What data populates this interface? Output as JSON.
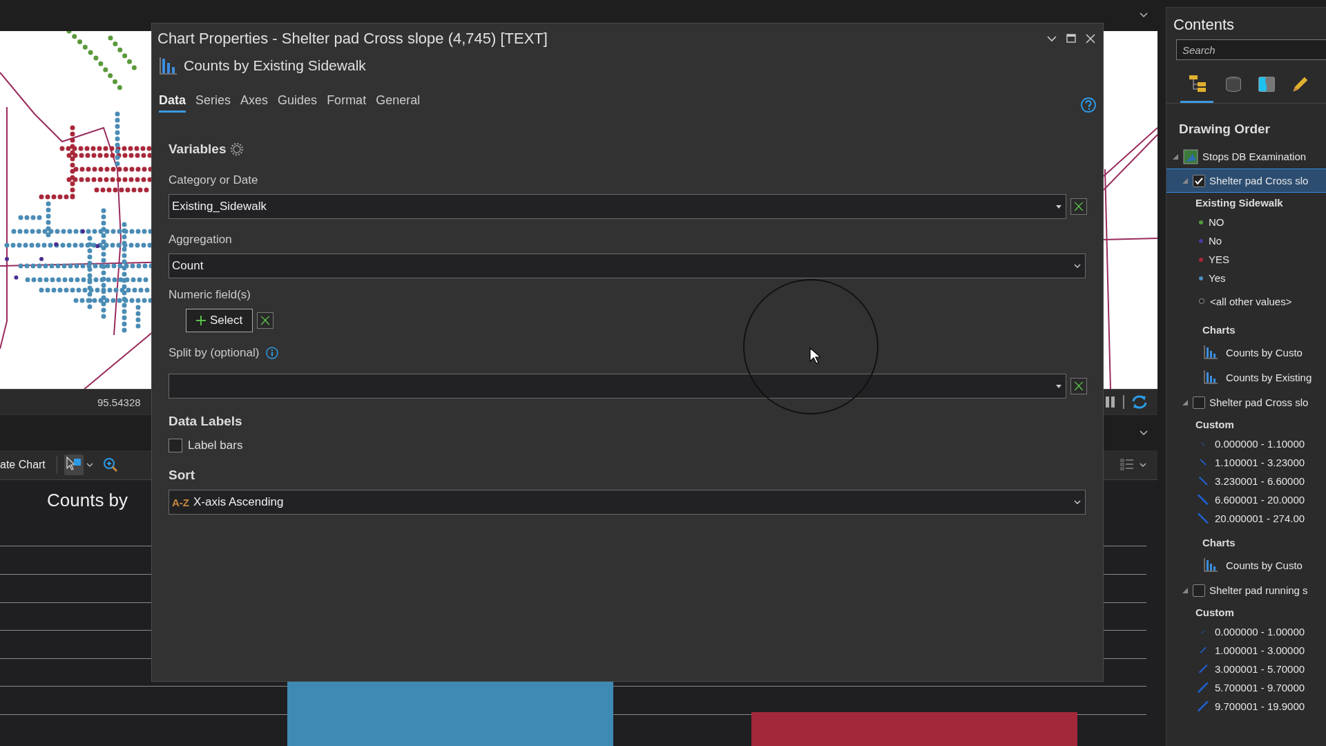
{
  "app": {
    "status_reading": "95.54328",
    "chart_pane": {
      "toolbar_label": "ate Chart",
      "chart_title": "Counts by"
    }
  },
  "dialog": {
    "title": "Chart Properties - Shelter pad Cross slope (4,745) [TEXT]",
    "chart_name": "Counts by Existing Sidewalk",
    "tabs": [
      {
        "label": "Data",
        "selected": true
      },
      {
        "label": "Series",
        "selected": false
      },
      {
        "label": "Axes",
        "selected": false
      },
      {
        "label": "Guides",
        "selected": false
      },
      {
        "label": "Format",
        "selected": false
      },
      {
        "label": "General",
        "selected": false
      }
    ],
    "variables": {
      "heading": "Variables",
      "fields": [
        {
          "kind": "dropdown",
          "label": "Category or Date",
          "value": "Existing_Sidewalk",
          "clearable": true,
          "info": false
        },
        {
          "kind": "dropdown",
          "label": "Aggregation",
          "value": "Count",
          "clearable": false,
          "info": false
        },
        {
          "kind": "select",
          "label": "Numeric field(s)",
          "button": "Select",
          "clearable": true,
          "info": false
        },
        {
          "kind": "dropdown",
          "label": "Split by (optional)",
          "clearable": true,
          "info": true
        }
      ]
    },
    "data_labels": {
      "heading": "Data Labels",
      "checkbox": {
        "label": "Label bars",
        "checked": false
      }
    },
    "sort": {
      "heading": "Sort",
      "icon_text": "A-Z",
      "value": "X-axis Ascending"
    }
  },
  "contents": {
    "title": "Contents",
    "search": {
      "placeholder": "Search"
    },
    "tabs": [
      {
        "kind": "drawing-order",
        "selected": true
      },
      {
        "kind": "source",
        "selected": false
      },
      {
        "kind": "map",
        "selected": false
      },
      {
        "kind": "editing",
        "selected": false
      }
    ],
    "heading": "Drawing Order",
    "tree": [
      {
        "label": "Stops DB Examination",
        "expanded": true,
        "children": [
          {
            "label": "Shelter pad Cross slo",
            "checked": true,
            "selected": true,
            "expanded": true,
            "legend": {
              "heading": "Existing Sidewalk",
              "items": [
                {
                  "label": "NO",
                  "kind": "point",
                  "color": "#4f9a3c"
                },
                {
                  "label": "No",
                  "kind": "point",
                  "color": "#4b3a9a"
                },
                {
                  "label": "YES",
                  "kind": "point",
                  "color": "#a8283a"
                },
                {
                  "label": "Yes",
                  "kind": "point",
                  "color": "#4a8ec0"
                },
                {
                  "label": "<all other values>",
                  "kind": "point",
                  "color": "#1e1e1e"
                }
              ]
            },
            "charts": {
              "heading": "Charts",
              "items": [
                "Counts by Custo",
                "Counts by Existing"
              ]
            }
          },
          {
            "label": "Shelter pad Cross slo",
            "checked": false,
            "selected": false,
            "expanded": true,
            "legend": {
              "heading": "Custom",
              "items": [
                {
                  "label": "0.000000 - 1.10000",
                  "kind": "line-down"
                },
                {
                  "label": "1.100001 - 3.23000",
                  "kind": "line-down"
                },
                {
                  "label": "3.230001 - 6.60000",
                  "kind": "line-down"
                },
                {
                  "label": "6.600001 - 20.0000",
                  "kind": "line-down"
                },
                {
                  "label": "20.000001 - 274.00",
                  "kind": "line-down"
                }
              ]
            },
            "charts": {
              "heading": "Charts",
              "items": [
                "Counts by Custo"
              ]
            }
          },
          {
            "label": "Shelter pad running s",
            "checked": false,
            "selected": false,
            "expanded": true,
            "legend": {
              "heading": "Custom",
              "items": [
                {
                  "label": "0.000000 - 1.00000",
                  "kind": "line-up"
                },
                {
                  "label": "1.000001 - 3.00000",
                  "kind": "line-up"
                },
                {
                  "label": "3.000001 - 5.70000",
                  "kind": "line-up"
                },
                {
                  "label": "5.700001 - 9.70000",
                  "kind": "line-up"
                },
                {
                  "label": "9.700001 - 19.9000",
                  "kind": "line-up"
                }
              ]
            }
          }
        ]
      }
    ]
  }
}
